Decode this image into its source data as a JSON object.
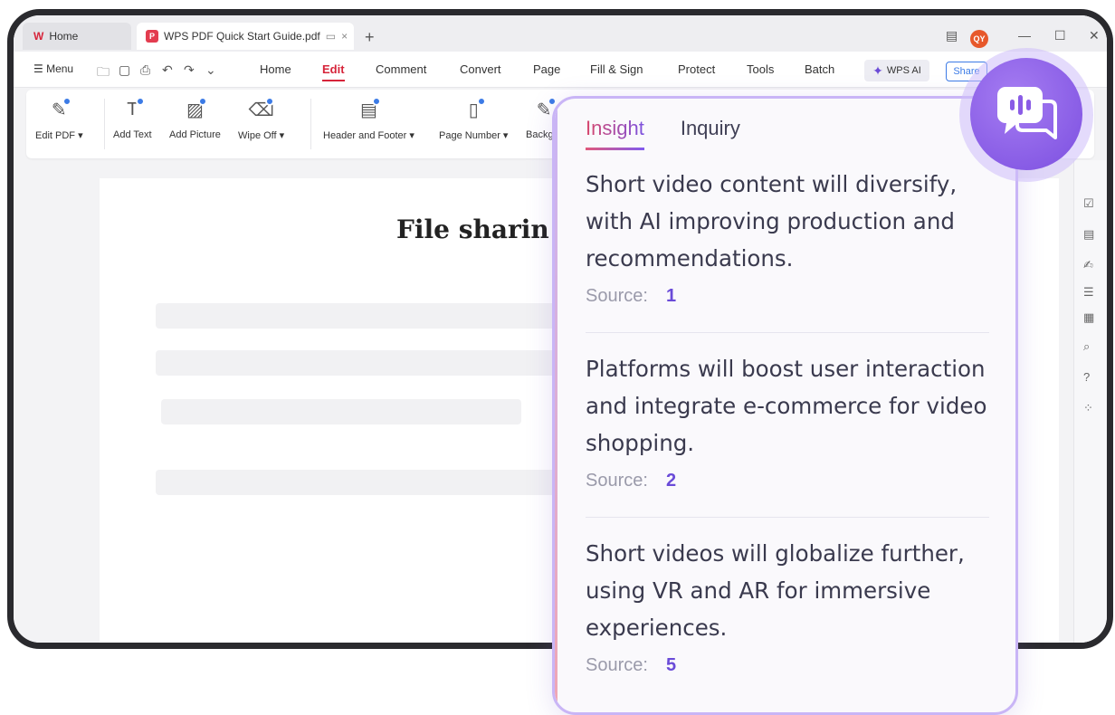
{
  "tabs": {
    "home": {
      "logo": "W",
      "label": "Home"
    },
    "doc": {
      "badge": "P",
      "label": "WPS PDF Quick Start Guide.pdf",
      "close": "×"
    },
    "new_tab": "+",
    "avatar": "QY"
  },
  "menu": {
    "menu_label": "☰ Menu",
    "items": [
      "Home",
      "Edit",
      "Comment",
      "Convert",
      "Page",
      "Fill & Sign",
      "Protect",
      "Tools",
      "Batch"
    ],
    "wps_ai": "WPS AI",
    "share": "Share"
  },
  "ribbon": {
    "tools": [
      {
        "label": "Edit PDF ▾",
        "icon": "edit-pdf-icon"
      },
      {
        "label": "Add Text",
        "icon": "add-text-icon"
      },
      {
        "label": "Add Picture",
        "icon": "add-picture-icon"
      },
      {
        "label": "Wipe Off ▾",
        "icon": "eraser-icon"
      },
      {
        "label": "Header and Footer ▾",
        "icon": "header-footer-icon"
      },
      {
        "label": "Page Number ▾",
        "icon": "page-number-icon"
      },
      {
        "label": "Backgro",
        "icon": "background-icon"
      }
    ]
  },
  "document": {
    "title": "File sharin"
  },
  "insight": {
    "tab_insight": "Insight",
    "tab_inquiry": "Inquiry",
    "source_label": "Source:",
    "items": [
      {
        "text": "Short video content will diversify, with AI improving production and recommendations.",
        "source": "1"
      },
      {
        "text": "Platforms will boost user interaction and integrate e-commerce for video shopping.",
        "source": "2"
      },
      {
        "text": "Short videos will globalize further, using VR and AR for immersive experiences.",
        "source": "5"
      }
    ]
  },
  "colors": {
    "accent_red": "#d6243a",
    "ai_purple": "#7c4fe0",
    "source_number": "#6a4bd8"
  }
}
